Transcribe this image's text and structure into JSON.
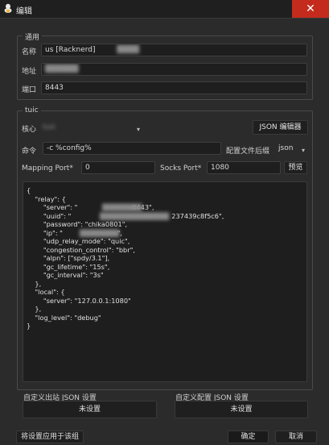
{
  "window": {
    "title": "编辑",
    "close_glyph": "✕"
  },
  "general": {
    "group_label": "通用",
    "name_label": "名称",
    "name_value": "us [Racknerd]",
    "address_label": "地址",
    "address_value": "",
    "port_label": "端口",
    "port_value": "8443"
  },
  "tuic": {
    "group_label": "tuic",
    "core_label": "核心",
    "core_value": "tuic",
    "json_editor_button": "JSON 编辑器",
    "command_label": "命令",
    "command_value": "-c %config%",
    "config_suffix_label": "配置文件后缀",
    "config_suffix_value": "json",
    "mapping_port_label": "Mapping Port*",
    "mapping_port_value": "0",
    "socks_port_label": "Socks Port*",
    "socks_port_value": "1080",
    "preview_button": "预览",
    "config_json": "{\n    \"relay\": {\n        \"server\": \"                         :8443\",\n        \"uuid\": \"                                                237439c8f5c6\",\n        \"password\": \"chika0801\",\n        \"ip\": \"                          \",\n        \"udp_relay_mode\": \"quic\",\n        \"congestion_control\": \"bbr\",\n        \"alpn\": [\"spdy/3.1\"],\n        \"gc_lifetime\": \"15s\",\n        \"gc_interval\": \"3s\"\n    },\n    \"local\": {\n        \"server\": \"127.0.0.1:1080\"\n    },\n    \"log_level\": \"debug\"\n}"
  },
  "custom_outbound": {
    "label": "自定义出站 JSON 设置",
    "button": "未设置"
  },
  "custom_config": {
    "label": "自定义配置 JSON 设置",
    "button": "未设置"
  },
  "footer": {
    "apply_group_button": "将设置应用于该组",
    "ok_button": "确定",
    "cancel_button": "取消"
  }
}
